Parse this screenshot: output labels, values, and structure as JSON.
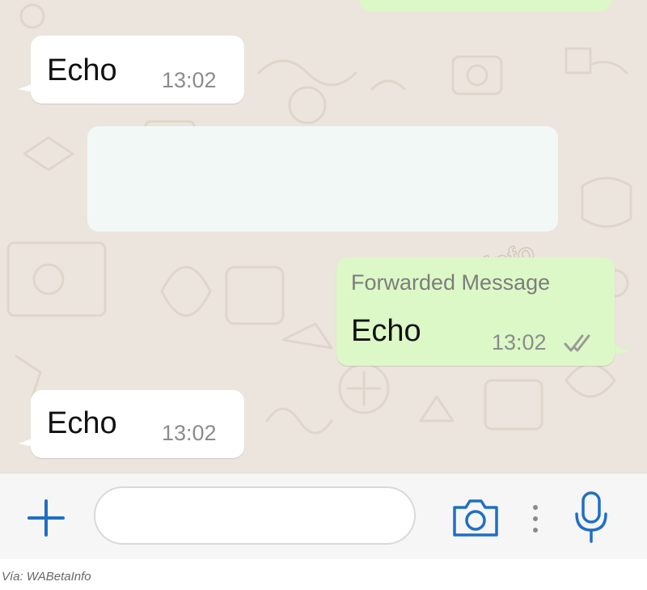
{
  "chat": {
    "messages": [
      {
        "direction": "incoming",
        "text": "Echo",
        "time": "13:02"
      },
      {
        "direction": "incoming",
        "text": "",
        "time": ""
      },
      {
        "direction": "outgoing",
        "forwarded_label": "Forwarded Message",
        "text": "Echo",
        "time": "13:02",
        "status_icon": "double-check-icon"
      },
      {
        "direction": "incoming",
        "text": "Echo",
        "time": "13:02"
      }
    ],
    "watermark": "@WABetaInfo"
  },
  "input_bar": {
    "placeholder": "",
    "icons": [
      "plus-icon",
      "camera-icon",
      "more-dots-icon",
      "microphone-icon"
    ]
  },
  "caption": "Vía: WABetaInfo",
  "colors": {
    "chat_background": "#ece5dd",
    "incoming_bubble": "#ffffff",
    "outgoing_bubble": "#dcf8c6",
    "accent_blue": "#1f6fc5"
  }
}
